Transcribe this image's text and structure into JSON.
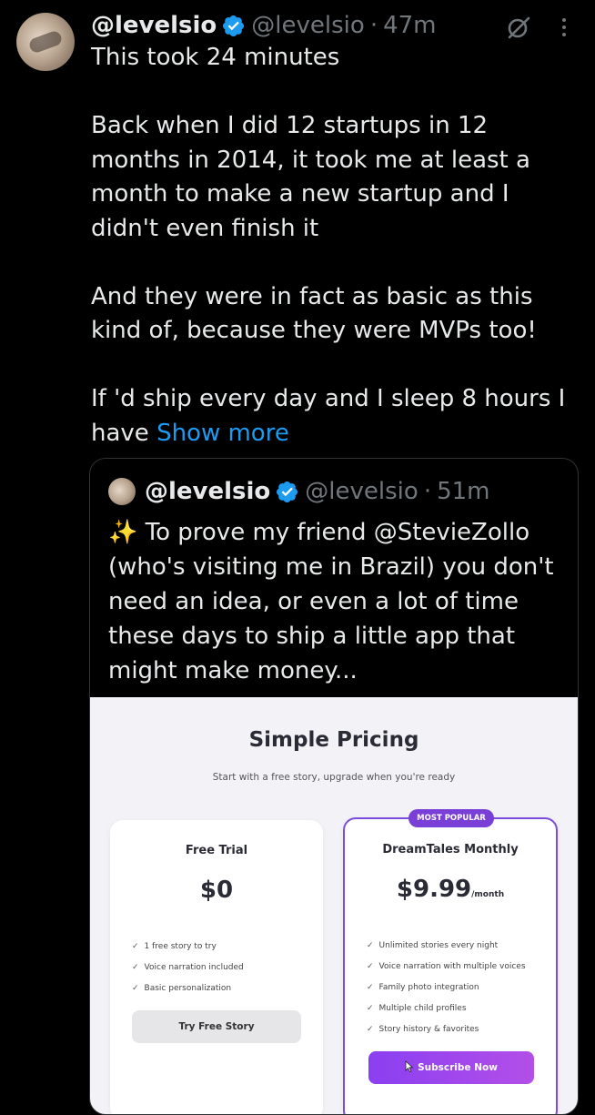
{
  "tweet": {
    "author_name": "@levelsio",
    "author_handle": "@levelsio",
    "separator": "·",
    "time": "47m",
    "lines": [
      "This took 24 minutes",
      "",
      "Back when I did 12 startups in 12 months in 2014, it took me at least a month to make a new startup and I didn't even finish it",
      "",
      "And they were in fact as basic as this kind of, because they were MVPs too!",
      "",
      "If 'd ship every day and I sleep 8 hours I have"
    ],
    "show_more": "Show more"
  },
  "quote": {
    "author_name": "@levelsio",
    "author_handle": "@levelsio",
    "separator": "·",
    "time": "51m",
    "text": "✨ To prove my friend @StevieZollo (who's visiting me in Brazil) you don't need an idea, or even a lot of time these days to ship a little app that might make money..."
  },
  "pricing": {
    "title": "Simple Pricing",
    "subtitle": "Start with a free story, upgrade when you're ready",
    "free": {
      "name": "Free Trial",
      "price": "$0",
      "features": [
        "1 free story to try",
        "Voice narration included",
        "Basic personalization"
      ],
      "button": "Try Free Story"
    },
    "pro": {
      "badge": "MOST POPULAR",
      "name": "DreamTales Monthly",
      "price": "$9.99",
      "period": "/month",
      "features": [
        "Unlimited stories every night",
        "Voice narration with multiple voices",
        "Family photo integration",
        "Multiple child profiles",
        "Story history & favorites"
      ],
      "button": "Subscribe Now"
    },
    "check": "✓"
  },
  "colors": {
    "background": "#000000",
    "text": "#e7e9ea",
    "muted": "#71767b",
    "link": "#1d9bf0",
    "verified": "#1d9bf0",
    "accent_purple": "#7c4ddc"
  },
  "icons": [
    "verified-badge-icon",
    "grok-icon",
    "more-options-icon",
    "sparkles-emoji",
    "check-icon",
    "cursor-icon"
  ]
}
